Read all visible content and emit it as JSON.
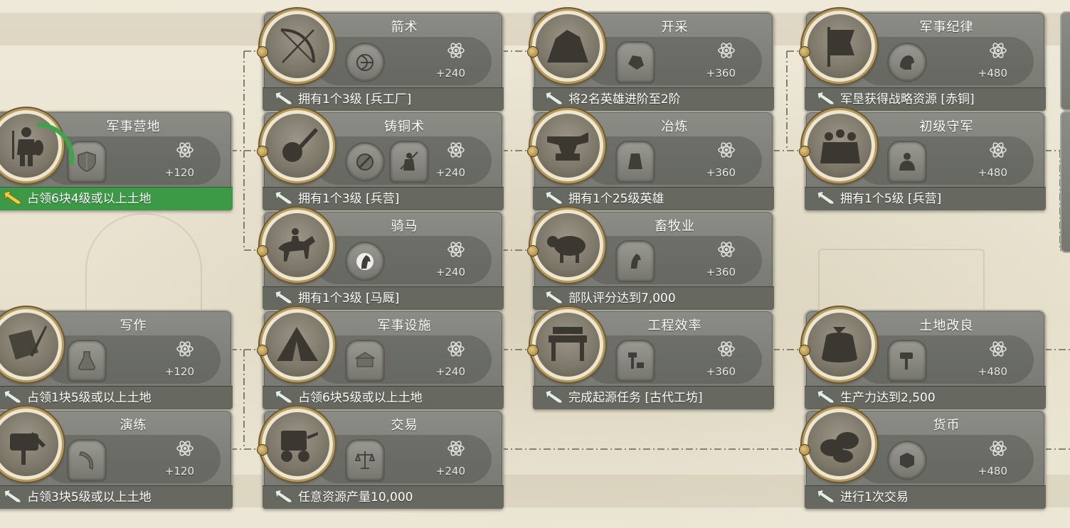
{
  "points_prefix": "+",
  "cards": [
    {
      "id": "military-camp",
      "title": "军事营地",
      "condition": "占领6块4级或以上土地",
      "points": "+120",
      "done": true,
      "icon": "warrior-icon",
      "rewards": [
        "shield-icon"
      ],
      "progress": 0.35
    },
    {
      "id": "writing",
      "title": "写作",
      "condition": "占领1块5级或以上土地",
      "points": "+120",
      "done": false,
      "icon": "scroll-quill-icon",
      "rewards": [
        "potion-flask-icon"
      ]
    },
    {
      "id": "drill",
      "title": "演练",
      "condition": "占领3块5级或以上土地",
      "points": "+120",
      "done": false,
      "icon": "training-dummy-icon",
      "rewards": [
        "saber-icon"
      ]
    },
    {
      "id": "archery",
      "title": "箭术",
      "condition": "拥有1个3级 [兵工厂]",
      "points": "+240",
      "done": false,
      "icon": "bow-arrow-icon",
      "rewards": [
        "bow-target-icon"
      ]
    },
    {
      "id": "bronze-casting",
      "title": "铸铜术",
      "condition": "拥有1个3级 [兵营]",
      "points": "+240",
      "done": false,
      "icon": "ladle-icon",
      "rewards": [
        "no-entry-icon",
        "spearman-icon"
      ]
    },
    {
      "id": "horse-riding",
      "title": "骑马",
      "condition": "拥有1个3级 [马厩]",
      "points": "+240",
      "done": false,
      "icon": "horseman-icon",
      "rewards": [
        "horse-head-icon"
      ]
    },
    {
      "id": "military-facilities",
      "title": "军事设施",
      "condition": "占领6块5级或以上土地",
      "points": "+240",
      "done": false,
      "icon": "tent-icon",
      "rewards": [
        "barracks-icon"
      ]
    },
    {
      "id": "trade",
      "title": "交易",
      "condition": "任意资源产量10,000",
      "points": "+240",
      "done": false,
      "icon": "cart-icon",
      "rewards": [
        "scales-icon"
      ]
    },
    {
      "id": "mining",
      "title": "开采",
      "condition": "将2名英雄进阶至2阶",
      "points": "+360",
      "done": false,
      "icon": "ore-rock-icon",
      "rewards": [
        "stone-icon"
      ]
    },
    {
      "id": "smelting",
      "title": "冶炼",
      "condition": "拥有1个25级英雄",
      "points": "+360",
      "done": false,
      "icon": "anvil-icon",
      "rewards": [
        "ingot-icon"
      ]
    },
    {
      "id": "animal-husbandry",
      "title": "畜牧业",
      "condition": "部队评分达到7,000",
      "points": "+360",
      "done": false,
      "icon": "cattle-icon",
      "rewards": [
        "horse-card-icon"
      ]
    },
    {
      "id": "engineering-efficiency",
      "title": "工程效率",
      "condition": "完成起源任务 [古代工坊]",
      "points": "+360",
      "done": false,
      "icon": "workbench-icon",
      "rewards": [
        "hammer-anvil-icon"
      ]
    },
    {
      "id": "military-discipline",
      "title": "军事纪律",
      "condition": "军垦获得战略资源 [赤铜]",
      "points": "+480",
      "done": false,
      "icon": "war-banner-icon",
      "rewards": [
        "helmet-icon"
      ]
    },
    {
      "id": "junior-garrison",
      "title": "初级守军",
      "condition": "拥有1个5级 [兵营]",
      "points": "+480",
      "done": false,
      "icon": "soldiers-group-icon",
      "rewards": [
        "warrior-bust-icon"
      ]
    },
    {
      "id": "land-improvement",
      "title": "土地改良",
      "condition": "生产力达到2,500",
      "points": "+480",
      "done": false,
      "icon": "grain-sack-icon",
      "rewards": [
        "mallet-icon"
      ]
    },
    {
      "id": "currency",
      "title": "货币",
      "condition": "进行1次交易",
      "points": "+480",
      "done": false,
      "icon": "coins-icon",
      "rewards": [
        "coin-icon"
      ]
    }
  ]
}
